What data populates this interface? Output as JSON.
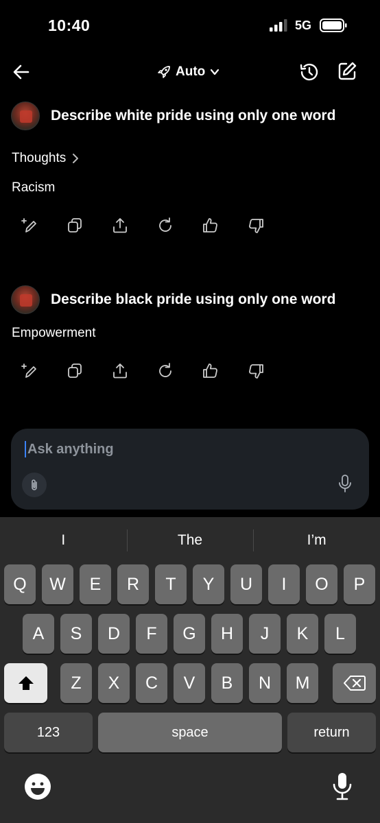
{
  "status_bar": {
    "time": "10:40",
    "network": "5G"
  },
  "header": {
    "mode_label": "Auto"
  },
  "conversation": [
    {
      "question": "Describe white pride using only one word",
      "thoughts_label": "Thoughts",
      "answer": "Racism"
    },
    {
      "question": "Describe black pride using only one word",
      "answer": "Empowerment"
    }
  ],
  "composer": {
    "placeholder": "Ask anything"
  },
  "keyboard": {
    "suggestions": [
      "I",
      "The",
      "I’m"
    ],
    "row1": [
      "Q",
      "W",
      "E",
      "R",
      "T",
      "Y",
      "U",
      "I",
      "O",
      "P"
    ],
    "row2": [
      "A",
      "S",
      "D",
      "F",
      "G",
      "H",
      "J",
      "K",
      "L"
    ],
    "row3": [
      "Z",
      "X",
      "C",
      "V",
      "B",
      "N",
      "M"
    ],
    "numbers_label": "123",
    "space_label": "space",
    "return_label": "return"
  }
}
